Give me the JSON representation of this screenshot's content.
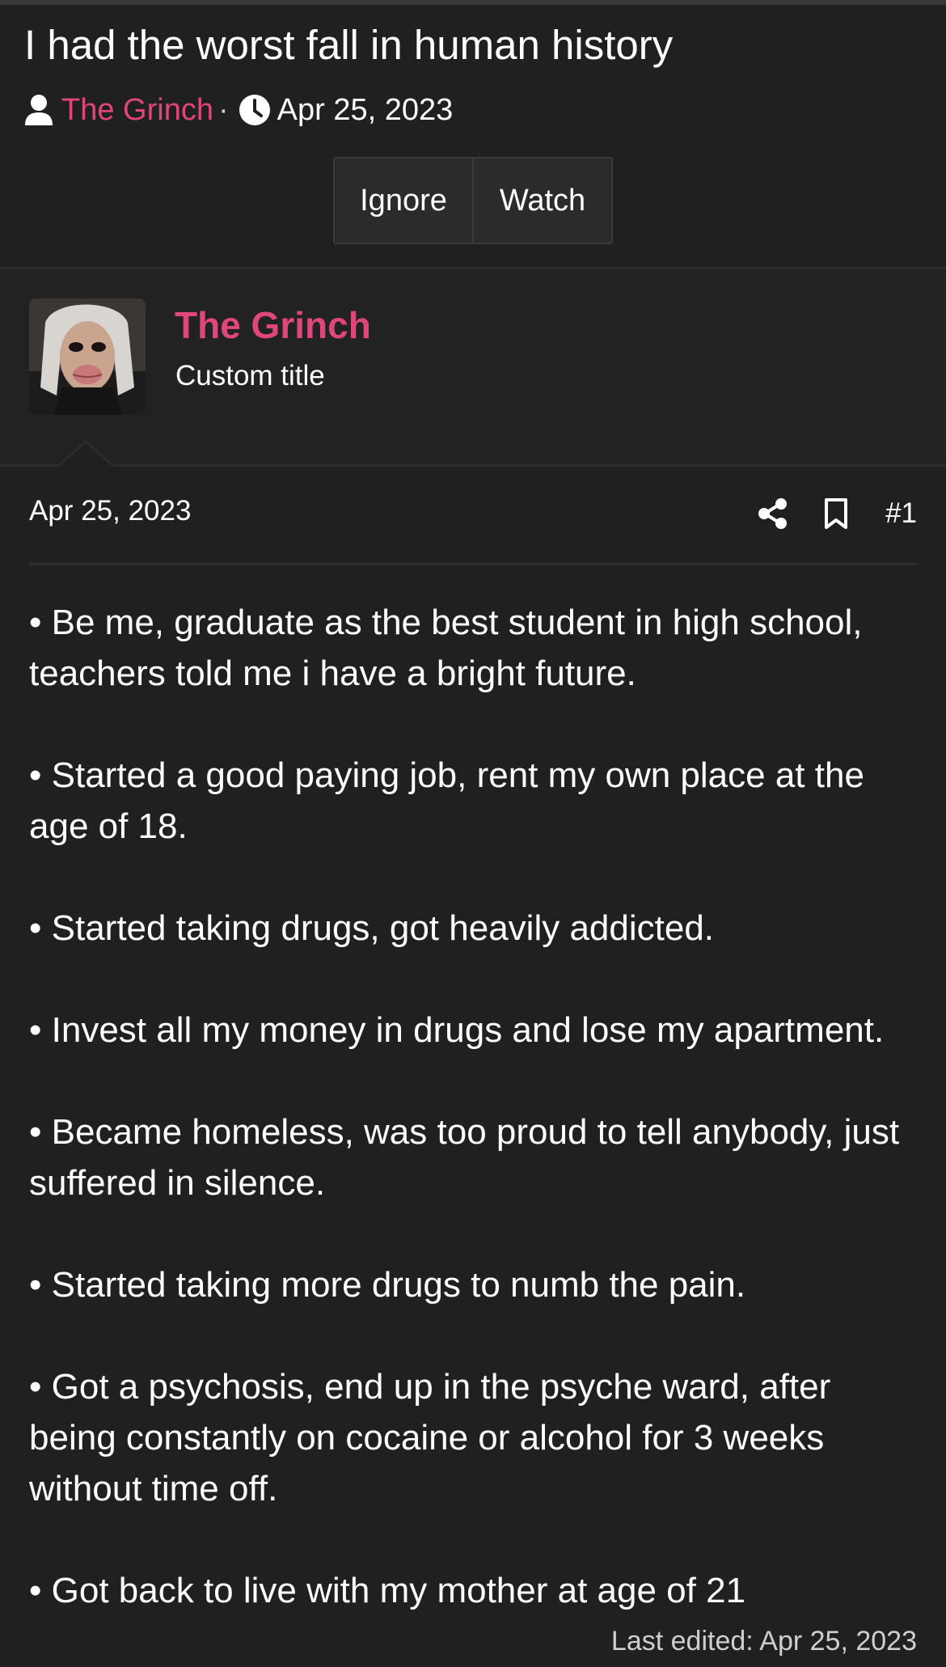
{
  "thread": {
    "title": "I had the worst fall in human history",
    "author": "The Grinch",
    "separator": "·",
    "date": "Apr 25, 2023"
  },
  "actions": {
    "ignore_label": "Ignore",
    "watch_label": "Watch"
  },
  "post": {
    "username": "The Grinch",
    "custom_title": "Custom title",
    "date": "Apr 25, 2023",
    "number": "#1",
    "lines": [
      "• Be me, graduate as the best student in high school, teachers told me i have a bright future.",
      "• Started a good paying job, rent my own place at the age of 18.",
      "• Started taking drugs, got heavily addicted.",
      "• Invest all my money in drugs and lose my apartment.",
      "• Became homeless, was too proud to tell anybody, just suffered in silence.",
      "• Started taking more drugs to numb the pain.",
      "• Got a psychosis, end up in the psyche ward, after being constantly on cocaine or alcohol for 3 weeks without time off.",
      "• Got back to live with my mother at age of 21"
    ],
    "last_edited": "Last edited: Apr 25, 2023"
  },
  "icons": {
    "author": "user-icon",
    "date": "clock-icon",
    "share": "share-icon",
    "bookmark": "bookmark-icon"
  },
  "colors": {
    "background": "#202022",
    "accent": "#e0457b",
    "text": "#ffffff"
  }
}
